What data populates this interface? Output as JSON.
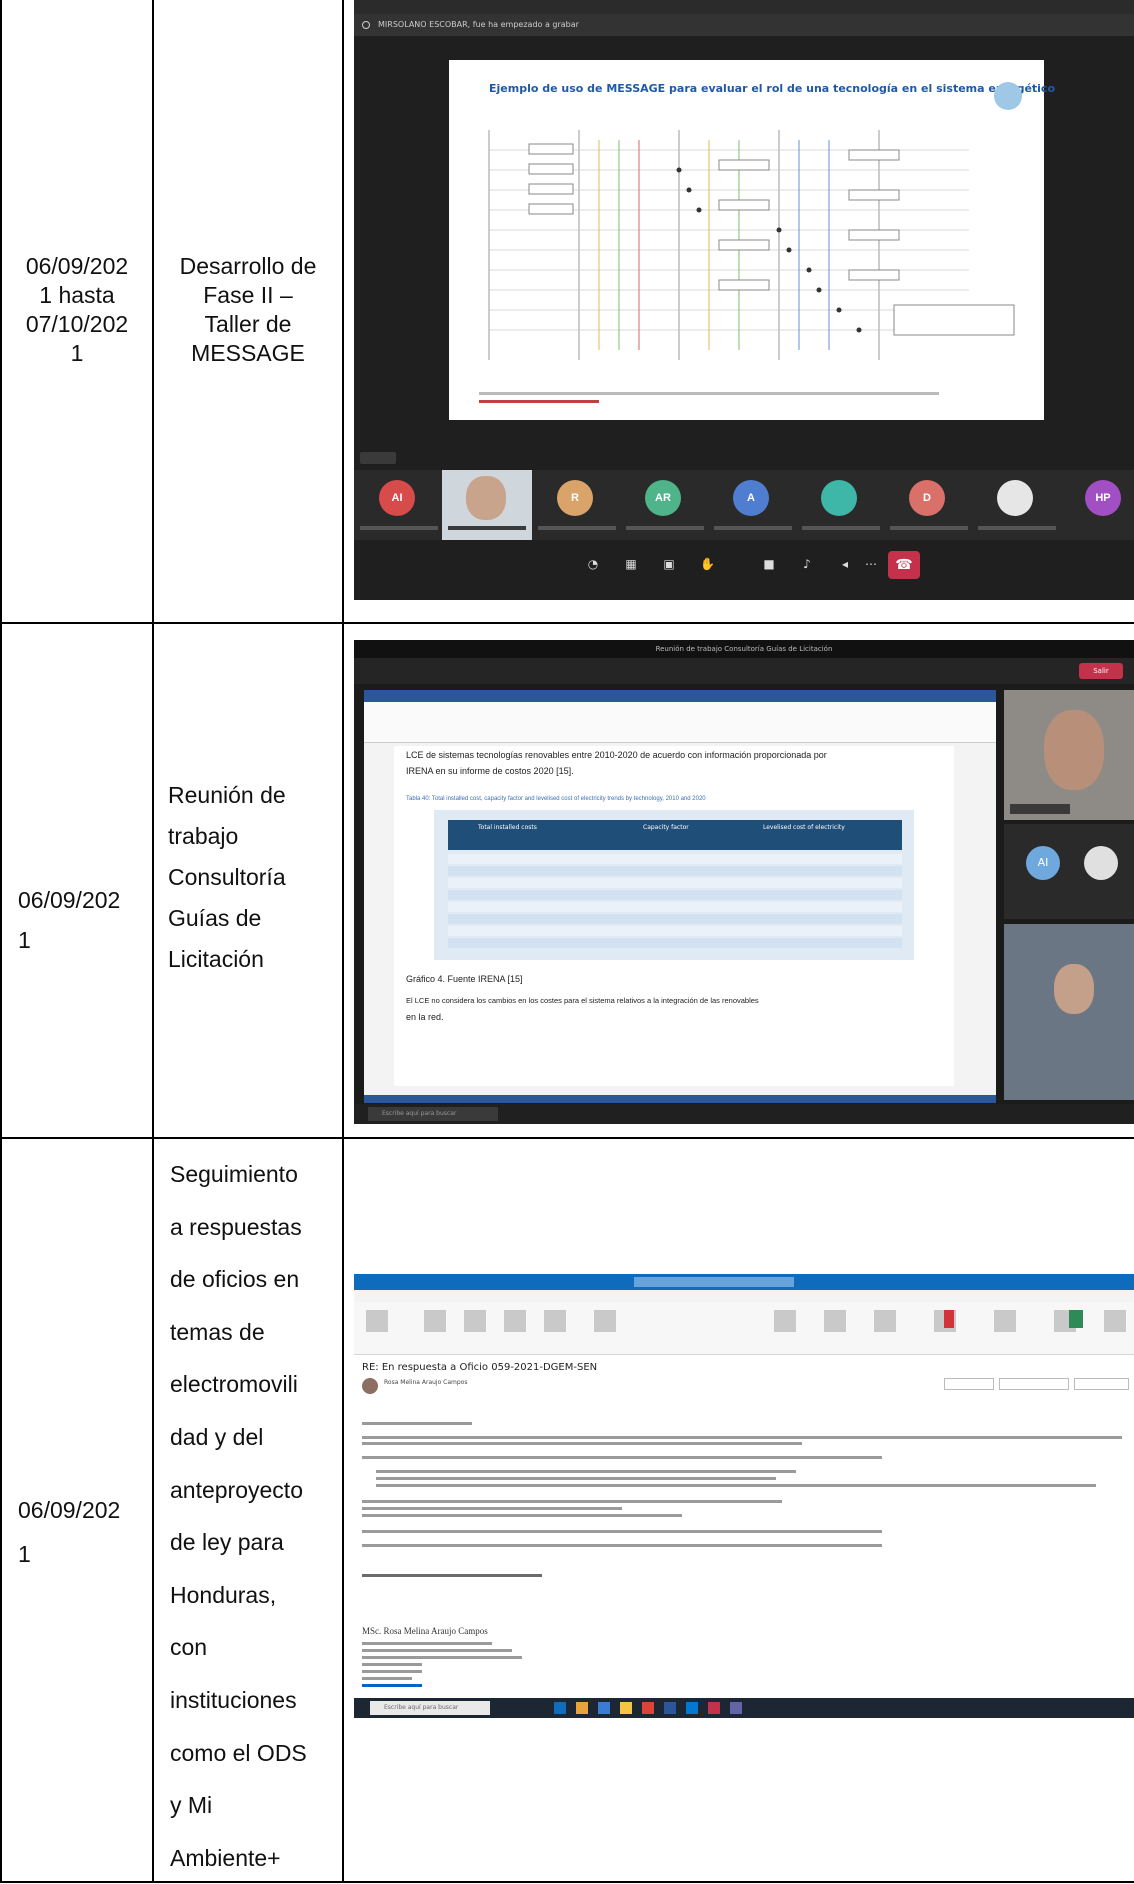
{
  "rows": [
    {
      "date": [
        "06/09/202",
        "1 hasta",
        "07/10/202",
        "1"
      ],
      "activity": [
        "Desarrollo de",
        "Fase II –",
        "Taller de",
        "MESSAGE"
      ],
      "screenshot": {
        "recording_notice": "MIRSOLANO ESCOBAR, fue ha empezado a grabar",
        "slide_title": "Ejemplo de uso de MESSAGE para evaluar el rol de una tecnología en el sistema energético",
        "participants": [
          {
            "initials": "AI",
            "color": "#d74b4b"
          },
          {
            "initials": "",
            "color": "#8b8b8b"
          },
          {
            "initials": "R",
            "color": "#d9a36a"
          },
          {
            "initials": "AR",
            "color": "#4fb48a"
          },
          {
            "initials": "A",
            "color": "#4f7ed1"
          },
          {
            "initials": "",
            "color": "#3fb7a8"
          },
          {
            "initials": "D",
            "color": "#d9706a"
          },
          {
            "initials": "",
            "color": "#e6e6e6"
          },
          {
            "initials": "HP",
            "color": "#a34fc4"
          }
        ]
      }
    },
    {
      "date": [
        "06/09/202",
        "1"
      ],
      "activity": [
        "Reunión de",
        "trabajo",
        "Consultoría",
        "Guías de",
        "Licitación"
      ],
      "screenshot": {
        "window_title": "Reunión de trabajo Consultoría Guías de Licitación",
        "leave_label": "Salir",
        "doc_line_1": "LCE de sistemas tecnologías renovables entre 2010-2020 de acuerdo con información proporcionada por",
        "doc_line_2": "IRENA en su informe de costos 2020 [15].",
        "table_caption": "Tabla 40: Total installed cost, capacity factor and levelised cost of electricity trends by technology, 2010 and 2020",
        "table_headers": [
          "Total installed costs",
          "Capacity factor",
          "Levelised cost of electricity"
        ],
        "graph_caption": "Gráfico 4. Fuente IRENA [15]",
        "doc_line_3": "El LCE no considera los cambios en los costes para el sistema relativos a la integración de las renovables",
        "doc_line_4": "en la red.",
        "video_participants": [
          {
            "initials": "AI",
            "color": "#6fa8dc"
          }
        ],
        "taskbar_search": "Escribe aquí para buscar"
      }
    },
    {
      "date": [
        "06/09/202",
        "1"
      ],
      "activity": [
        "Seguimiento",
        "a respuestas",
        "de oficios en",
        "temas de",
        "electromovili",
        "dad y del",
        "anteproyecto",
        "de ley para",
        "Honduras,",
        "con",
        "instituciones",
        "como el ODS",
        "y Mi",
        "Ambiente+"
      ],
      "screenshot": {
        "subject": "RE: En respuesta a Oficio 059-2021-DGEM-SEN",
        "sender": "Rosa Melina Araujo Campos",
        "signature": "MSc. Rosa Melina Araujo Campos",
        "taskbar_search": "Escribe aquí para buscar"
      }
    }
  ]
}
